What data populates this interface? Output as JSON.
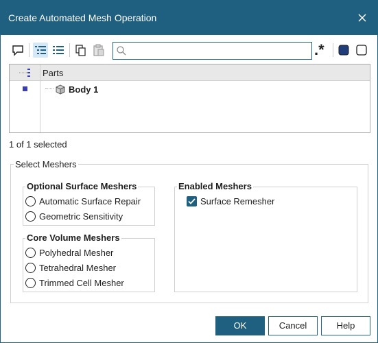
{
  "window": {
    "title": "Create Automated Mesh Operation"
  },
  "toolbar": {
    "buttons": [
      "comment-icon",
      "tree-view-icon",
      "list-view-icon",
      "copy-icon",
      "paste-icon"
    ],
    "search": {
      "value": "",
      "placeholder": ""
    },
    "regex_label": ".*",
    "right_buttons": [
      "select-all-icon",
      "deselect-all-icon"
    ]
  },
  "tree": {
    "header": "Parts",
    "rows": [
      {
        "label": "Body 1",
        "selected": true
      }
    ]
  },
  "selection_status": "1 of 1 selected",
  "meshers": {
    "group_label": "Select Meshers",
    "optional_surface": {
      "title": "Optional Surface Meshers",
      "items": [
        "Automatic Surface Repair",
        "Geometric Sensitivity"
      ]
    },
    "core_volume": {
      "title": "Core Volume Meshers",
      "items": [
        "Polyhedral Mesher",
        "Tetrahedral Mesher",
        "Trimmed Cell Mesher"
      ]
    },
    "enabled": {
      "title": "Enabled Meshers",
      "items": [
        {
          "label": "Surface Remesher",
          "checked": true
        }
      ]
    }
  },
  "footer": {
    "ok": "OK",
    "cancel": "Cancel",
    "help": "Help"
  },
  "colors": {
    "accent": "#1f5f7f",
    "selection_marker": "#3a3fb0"
  }
}
